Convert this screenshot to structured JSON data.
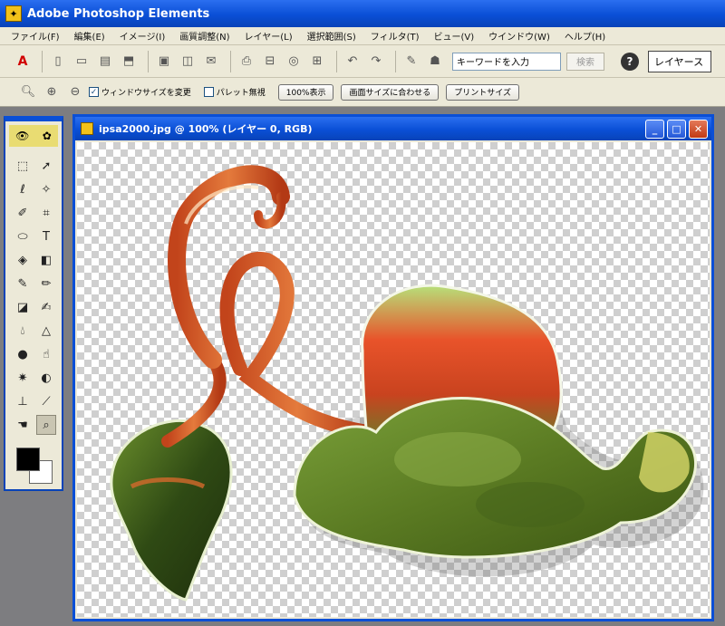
{
  "app": {
    "title": "Adobe Photoshop Elements",
    "icon": "photoshop-elements-icon"
  },
  "menu": [
    "ファイル(F)",
    "編集(E)",
    "イメージ(I)",
    "画質調整(N)",
    "レイヤー(L)",
    "選択範囲(S)",
    "フィルタ(T)",
    "ビュー(V)",
    "ウインドウ(W)",
    "ヘルプ(H)"
  ],
  "toolbar": {
    "search_value": "キーワードを入力",
    "search_button": "検索",
    "help_label": "?",
    "layers_tab": "レイヤース"
  },
  "options_bar": {
    "resize_windows_label": "ウィンドウサイズを変更",
    "resize_windows_checked": true,
    "ignore_palettes_label": "パレット無視",
    "ignore_palettes_checked": false,
    "actual_pixels_button": "100%表示",
    "fit_on_screen_button": "画面サイズに合わせる",
    "print_size_button": "プリントサイズ"
  },
  "document": {
    "title": "ipsa2000.jpg @ 100% (レイヤー 0, RGB)"
  },
  "colors": {
    "titlebar": "#0a4fd6",
    "chrome": "#ece9d8",
    "workspace": "#7d7d80",
    "foreground": "#000000",
    "background": "#ffffff"
  }
}
